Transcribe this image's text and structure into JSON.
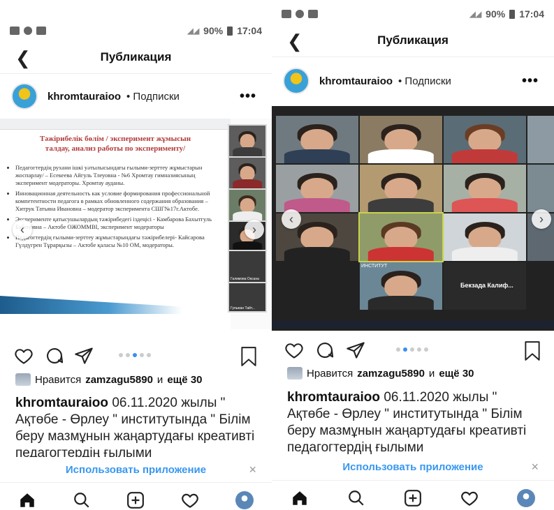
{
  "status_bar": {
    "battery": "90%",
    "time": "17:04"
  },
  "header": {
    "title": "Публикация"
  },
  "post": {
    "username": "khromtauraioo",
    "follow_label": "• Подписки",
    "more": "•••",
    "likes_prefix": "Нравится",
    "likes_user": "zamzagu5890",
    "likes_conjunction": "и",
    "likes_more": "ещё 30",
    "caption_text": "06.11.2020 жылы \" Ақтөбе - Өрлеу \" институтында \" Білім беру мазмұнын жаңартудағы креативті педагогтердің ғылыми"
  },
  "app_banner": {
    "label": "Использовать приложение",
    "close": "×"
  },
  "left_media": {
    "slide_title": "Тәжірибелік бөлім / эксперимент жұмысын талдау, анализ работы по эксперименту/",
    "bullets": [
      "Педагогтердің рухани ішкі уәтылысындағы ғылыми-зерттеу жұмыстарын жоспарлау/ – Есекеева Айгуль Тлеуовна - №6 Хромтау гимназиясының эксперимент модераторы. Хромтау ауданы.",
      "Инновационная деятельность как условие формирования профессиональной компетентности педагога в рамках обновленного содержания образования – Хитрук Татьяна Ивановна – модератор эксперимента СШГ№17г.Актобе.",
      "Эксперименте қатысушылардың тәжірибедегі іздеңісі - Камбарова Бахытгуль Бабеновна – Актобе ОЖОММВІ, эксперимент модераторы",
      "Педагогтердің ғылыми-зерттеу жұмыстарындағы тәжірибелері- Кайсарова Гүлдүгрен Тұрарқызы – Актобе қаласы №10 ОМ, модераторы."
    ],
    "side_labels": [
      "Галимова Оксана",
      "Гульжан Тайт..."
    ]
  },
  "right_media": {
    "name_tile": "Бекзада Калиф...",
    "tile_label_institute": "ИНСТИТУТ"
  },
  "carousel": {
    "active_index": 2,
    "count": 5
  },
  "colors": {
    "link_blue": "#3897f0",
    "dot_active": "#3b8ff3"
  }
}
